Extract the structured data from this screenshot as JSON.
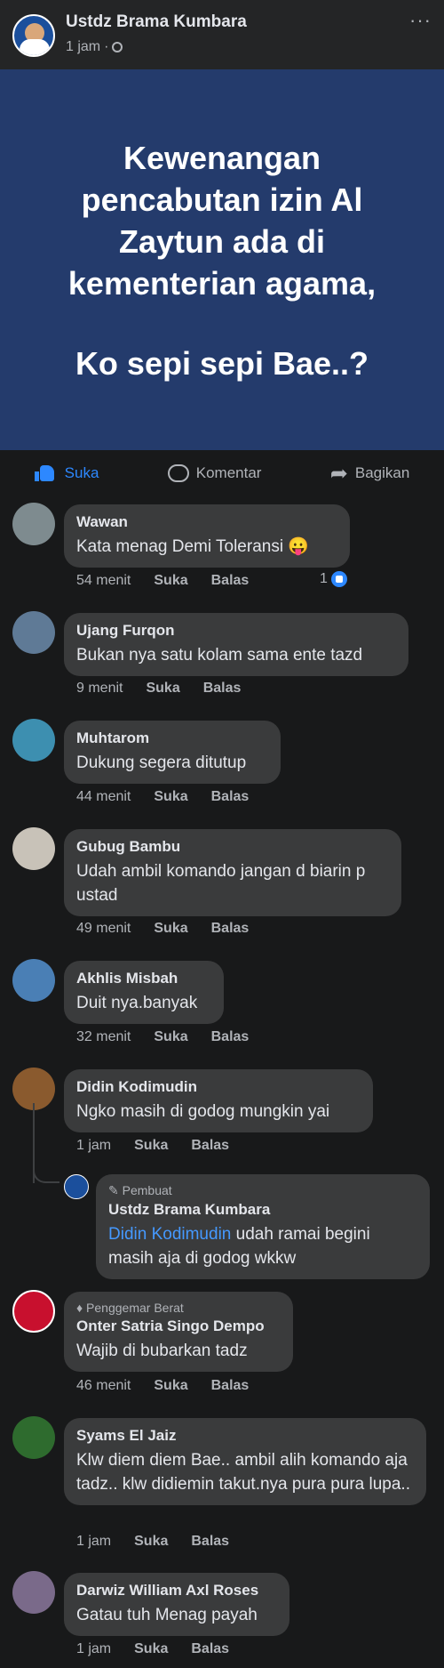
{
  "post": {
    "author": "Ustdz Brama Kumbara",
    "time": "1 jam",
    "meta_sep": "·",
    "more": "···",
    "headline": "Kewenangan pencabutan izin Al Zaytun ada di kementerian agama,",
    "question": "Ko sepi sepi Bae..?"
  },
  "actions": {
    "like": "Suka",
    "comment": "Komentar",
    "share": "Bagikan"
  },
  "comments": [
    {
      "name": "Wawan",
      "text": "Kata menag Demi Toleransi 😛",
      "time": "54 menit",
      "like": "Suka",
      "reply": "Balas",
      "reactions": "1"
    },
    {
      "name": "Ujang Furqon",
      "text": "Bukan nya satu kolam sama ente tazd",
      "time": "9 menit",
      "like": "Suka",
      "reply": "Balas"
    },
    {
      "name": "Muhtarom",
      "text": "Dukung segera ditutup",
      "time": "44 menit",
      "like": "Suka",
      "reply": "Balas"
    },
    {
      "name": "Gubug Bambu",
      "text": "Udah ambil komando jangan d biarin p ustad",
      "time": "49 menit",
      "like": "Suka",
      "reply": "Balas"
    },
    {
      "name": "Akhlis Misbah",
      "text": "Duit nya.banyak",
      "time": "32 menit",
      "like": "Suka",
      "reply": "Balas"
    },
    {
      "name": "Didin Kodimudin",
      "text": "Ngko masih di godog mungkin yai",
      "time": "1 jam",
      "like": "Suka",
      "reply": "Balas"
    },
    {
      "badge": "Penggemar Berat",
      "name": "Onter Satria Singo Dempo",
      "text": "Wajib di bubarkan tadz",
      "time": "46 menit",
      "like": "Suka",
      "reply": "Balas"
    },
    {
      "name": "Syams El Jaiz",
      "text": "Klw diem diem Bae.. ambil alih komando aja tadz.. klw didiemin takut.nya pura pura lupa..",
      "time": "1 jam",
      "like": "Suka",
      "reply": "Balas"
    },
    {
      "name": "Darwiz William Axl Roses",
      "text": "Gatau tuh Menag payah",
      "time": "1 jam",
      "like": "Suka",
      "reply": "Balas"
    }
  ],
  "reply": {
    "badge": "Pembuat",
    "name": "Ustdz Brama Kumbara",
    "mention": "Didin Kodimudin",
    "text": "udah ramai begini masih aja di godog wkkw"
  },
  "colors": {
    "background": "#18191a",
    "bubble": "#3a3b3c",
    "image_bg": "#243b6c",
    "accent": "#2d88ff"
  }
}
